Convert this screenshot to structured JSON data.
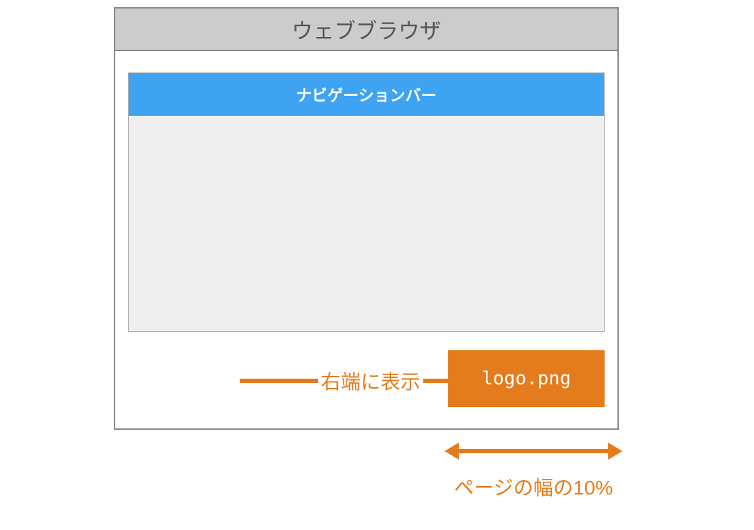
{
  "browser": {
    "title": "ウェブブラウザ"
  },
  "navbar": {
    "label": "ナビゲーションバー"
  },
  "logo": {
    "filename": "logo.png"
  },
  "annotations": {
    "align_right": "右端に表示",
    "width_note": "ページの幅の10%"
  },
  "colors": {
    "accent": "#e47c1d",
    "navbar": "#3ea3f0",
    "titlebar": "#cccccc",
    "page_bg": "#eeeeee"
  }
}
